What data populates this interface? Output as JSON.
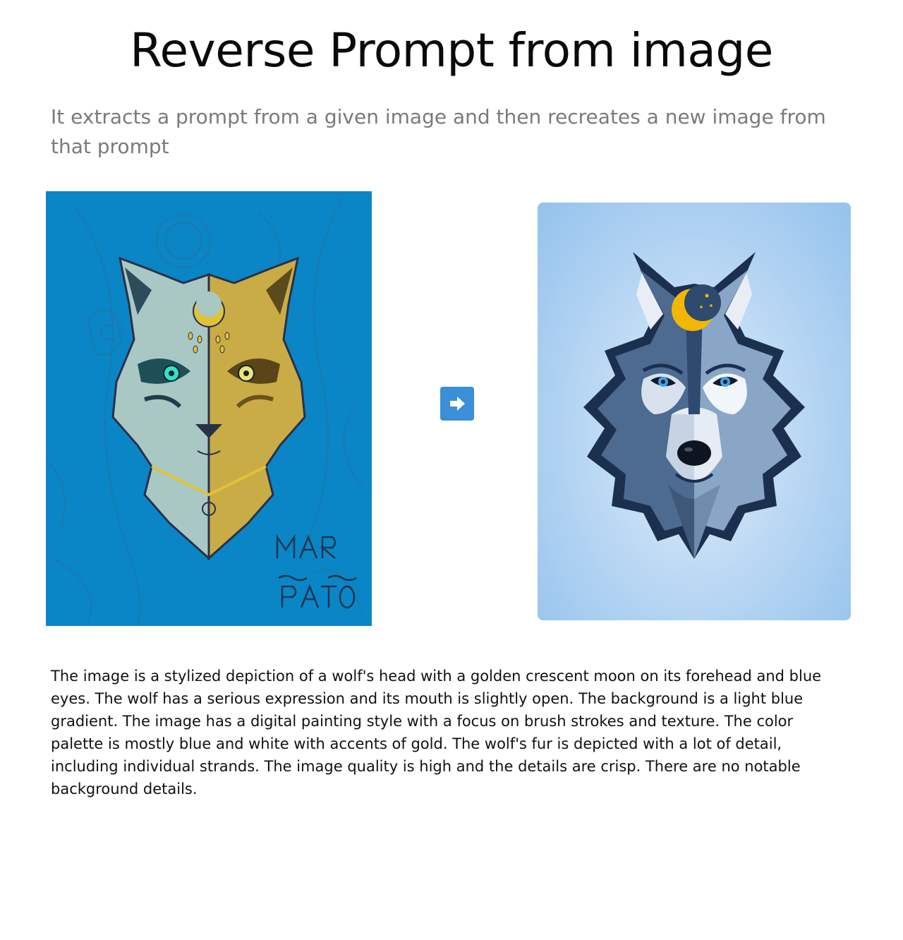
{
  "header": {
    "title": "Reverse Prompt from image",
    "subtitle": "It extracts a prompt from a given image and then recreates a new image from that prompt"
  },
  "source_image": {
    "signature_text": "MAR del PATO",
    "background_color": "#0a86c6"
  },
  "arrow": {
    "icon": "arrow-right-icon",
    "color": "#3b8fd6"
  },
  "result_image": {
    "background_color": "#94c2ec"
  },
  "description": {
    "text": "The image is a stylized depiction of a wolf's head with a golden crescent moon on its forehead and blue eyes. The wolf has a serious expression and its mouth is slightly open. The background is a light blue gradient. The image has a digital painting style with a focus on brush strokes and texture. The color palette is mostly blue and white with accents of gold. The wolf's fur is depicted with a lot of detail, including individual strands. The image quality is high and the details are crisp. There are no notable background details."
  }
}
